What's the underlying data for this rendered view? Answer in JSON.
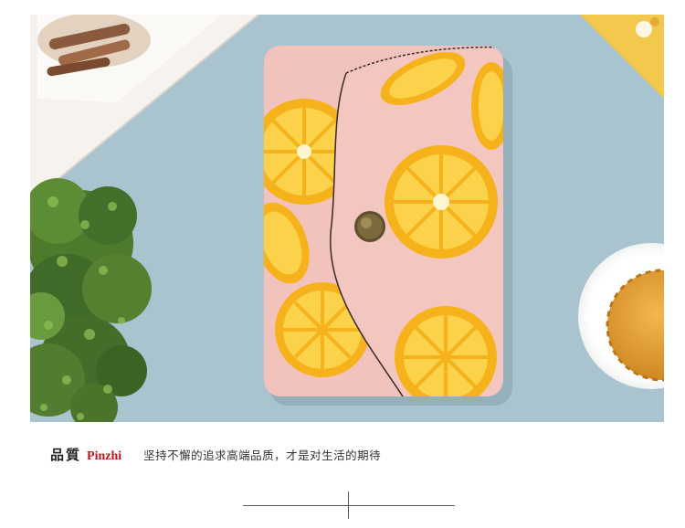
{
  "photo": {
    "subject": "lemon-print-canvas-card-wallet",
    "colors": {
      "background": "#a9c3cf",
      "wallet_pink": "#f2c3bd",
      "lemon_yellow": "#f6b21a",
      "lemon_light": "#fbd24a",
      "snap_button": "#7b6a3d"
    }
  },
  "caption": {
    "title": "品質",
    "brand": "Pinzhi",
    "slogan": "坚持不懈的追求高端品质，才是对生活的期待"
  }
}
